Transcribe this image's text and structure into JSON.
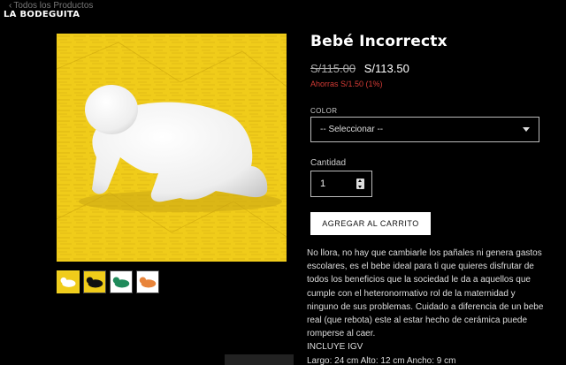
{
  "header": {
    "back_link": "Todos los Productos",
    "store_name": "LA BODEGUITA"
  },
  "product": {
    "title": "Bebé Incorrectx",
    "price_old": "S/115.00",
    "price_new": "S/113.50",
    "savings": "Ahorras S/1.50 (1%)",
    "color_label": "COLOR",
    "color_selected": "-- Seleccionar --",
    "quantity_label": "Cantidad",
    "quantity_value": "1",
    "add_to_cart_label": "AGREGAR AL CARRITO",
    "description": "No llora, no hay que cambiarle los pañales ni genera gastos escolares, es el bebe ideal para ti que quieres disfrutar de todos los beneficios que la sociedad le da a aquellos que cumple con el heteronormativo rol de la maternidad y ninguno de sus problemas. Cuidado a diferencia de un bebe real (que rebota) este al estar hecho de cerámica puede romperse al caer.",
    "igv_note": "INCLUYE IGV",
    "dimensions": "Largo: 24 cm Alto: 12 cm Ancho: 9 cm"
  },
  "gallery": {
    "thumbnails": [
      {
        "background": "#f0cc1a",
        "figure": "#ffffff",
        "active": true
      },
      {
        "background": "#f0cc1a",
        "figure": "#111111",
        "active": false
      },
      {
        "background": "#ffffff",
        "figure": "#1f8a5a",
        "active": false
      },
      {
        "background": "#ffffff",
        "figure": "#e8843a",
        "active": false
      }
    ]
  },
  "colors": {
    "accent_yellow": "#f0cc1a",
    "savings_red": "#d43b35",
    "background": "#000000"
  }
}
